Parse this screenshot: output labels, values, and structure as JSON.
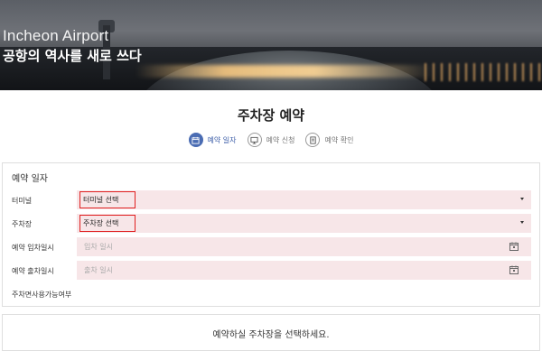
{
  "hero": {
    "title": "Incheon Airport",
    "subtitle": "공항의 역사를 새로 쓰다"
  },
  "page": {
    "title": "주차장 예약"
  },
  "steps": [
    {
      "label": "예약 일자",
      "icon": "calendar-icon",
      "active": true
    },
    {
      "label": "예약 신청",
      "icon": "monitor-icon",
      "active": false
    },
    {
      "label": "예약 확인",
      "icon": "document-icon",
      "active": false
    }
  ],
  "form": {
    "section_title": "예약 일자",
    "terminal": {
      "label": "터미널",
      "value": "터미널 선택"
    },
    "parking": {
      "label": "주차장",
      "value": "주차장 선택"
    },
    "entry": {
      "label": "예약 입차일시",
      "placeholder": "입차 일시"
    },
    "exit": {
      "label": "예약 출차일시",
      "placeholder": "출차 일시"
    },
    "availability_label": "주차면사용가능여부"
  },
  "notice": {
    "text": "예약하실 주차장을 선택하세요."
  },
  "colors": {
    "accent": "#4a6cb3",
    "field_bg": "#f7e6e8",
    "highlight_border": "#e02020"
  }
}
